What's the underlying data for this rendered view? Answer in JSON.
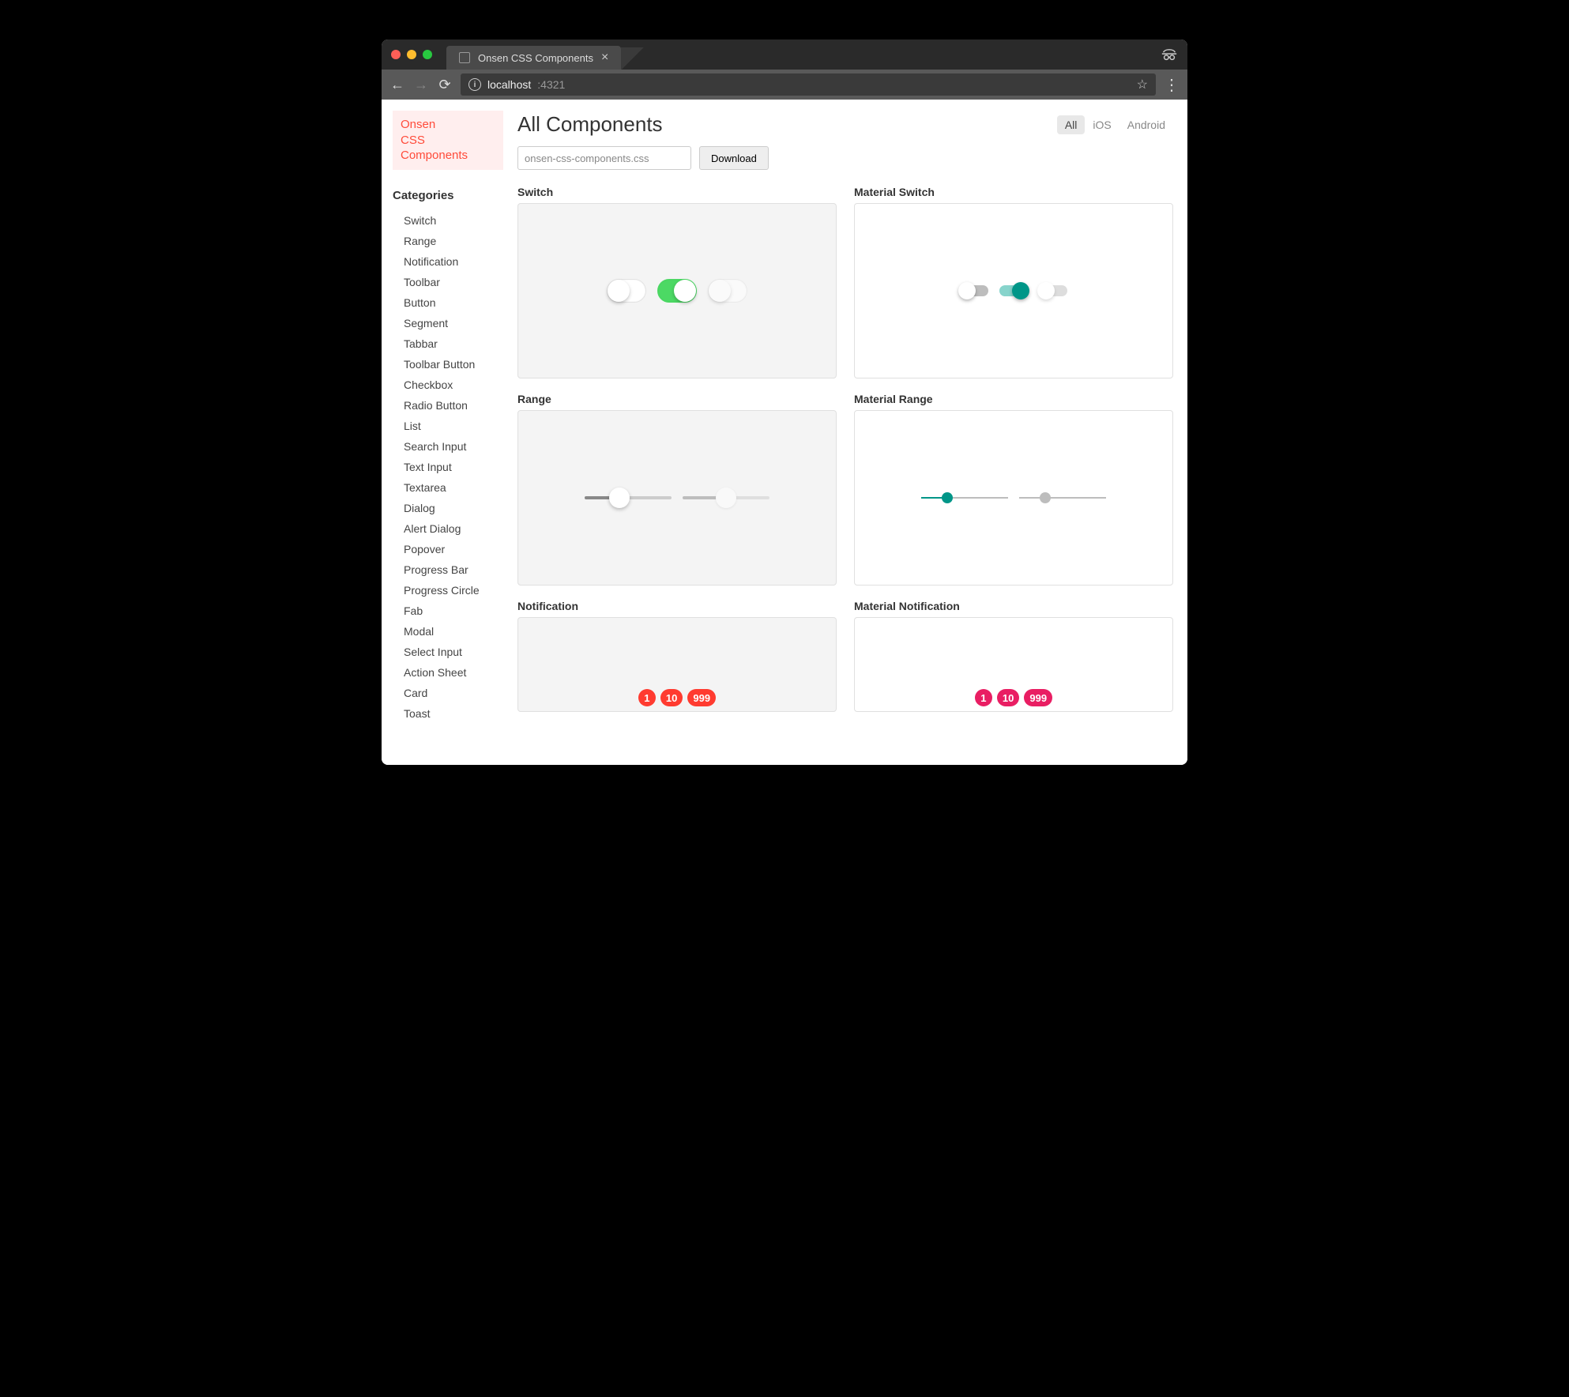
{
  "browser": {
    "tab_title": "Onsen CSS Components",
    "url_host": "localhost",
    "url_port": ":4321"
  },
  "logo": {
    "line1": "Onsen",
    "line2": "CSS",
    "line3": "Components"
  },
  "sidebar": {
    "heading": "Categories",
    "items": [
      "Switch",
      "Range",
      "Notification",
      "Toolbar",
      "Button",
      "Segment",
      "Tabbar",
      "Toolbar Button",
      "Checkbox",
      "Radio Button",
      "List",
      "Search Input",
      "Text Input",
      "Textarea",
      "Dialog",
      "Alert Dialog",
      "Popover",
      "Progress Bar",
      "Progress Circle",
      "Fab",
      "Modal",
      "Select Input",
      "Action Sheet",
      "Card",
      "Toast"
    ]
  },
  "header": {
    "title": "All Components",
    "platforms": [
      "All",
      "iOS",
      "Android"
    ],
    "active_platform": "All"
  },
  "download": {
    "filename": "onsen-css-components.css",
    "button": "Download"
  },
  "components": {
    "switch_ios": {
      "label": "Switch"
    },
    "switch_md": {
      "label": "Material Switch"
    },
    "range_ios": {
      "label": "Range",
      "value": 40,
      "disabled_value": 50
    },
    "range_md": {
      "label": "Material Range",
      "value": 30,
      "disabled_value": 30
    },
    "notif_ios": {
      "label": "Notification",
      "badges": [
        "1",
        "10",
        "999"
      ]
    },
    "notif_md": {
      "label": "Material Notification",
      "badges": [
        "1",
        "10",
        "999"
      ]
    }
  },
  "colors": {
    "logo_bg": "#ffeeee",
    "logo_fg": "#ff4b3a",
    "ios_accent": "#4cd964",
    "md_accent": "#009688",
    "ios_badge": "#ff3b30",
    "md_badge": "#e91e63"
  }
}
